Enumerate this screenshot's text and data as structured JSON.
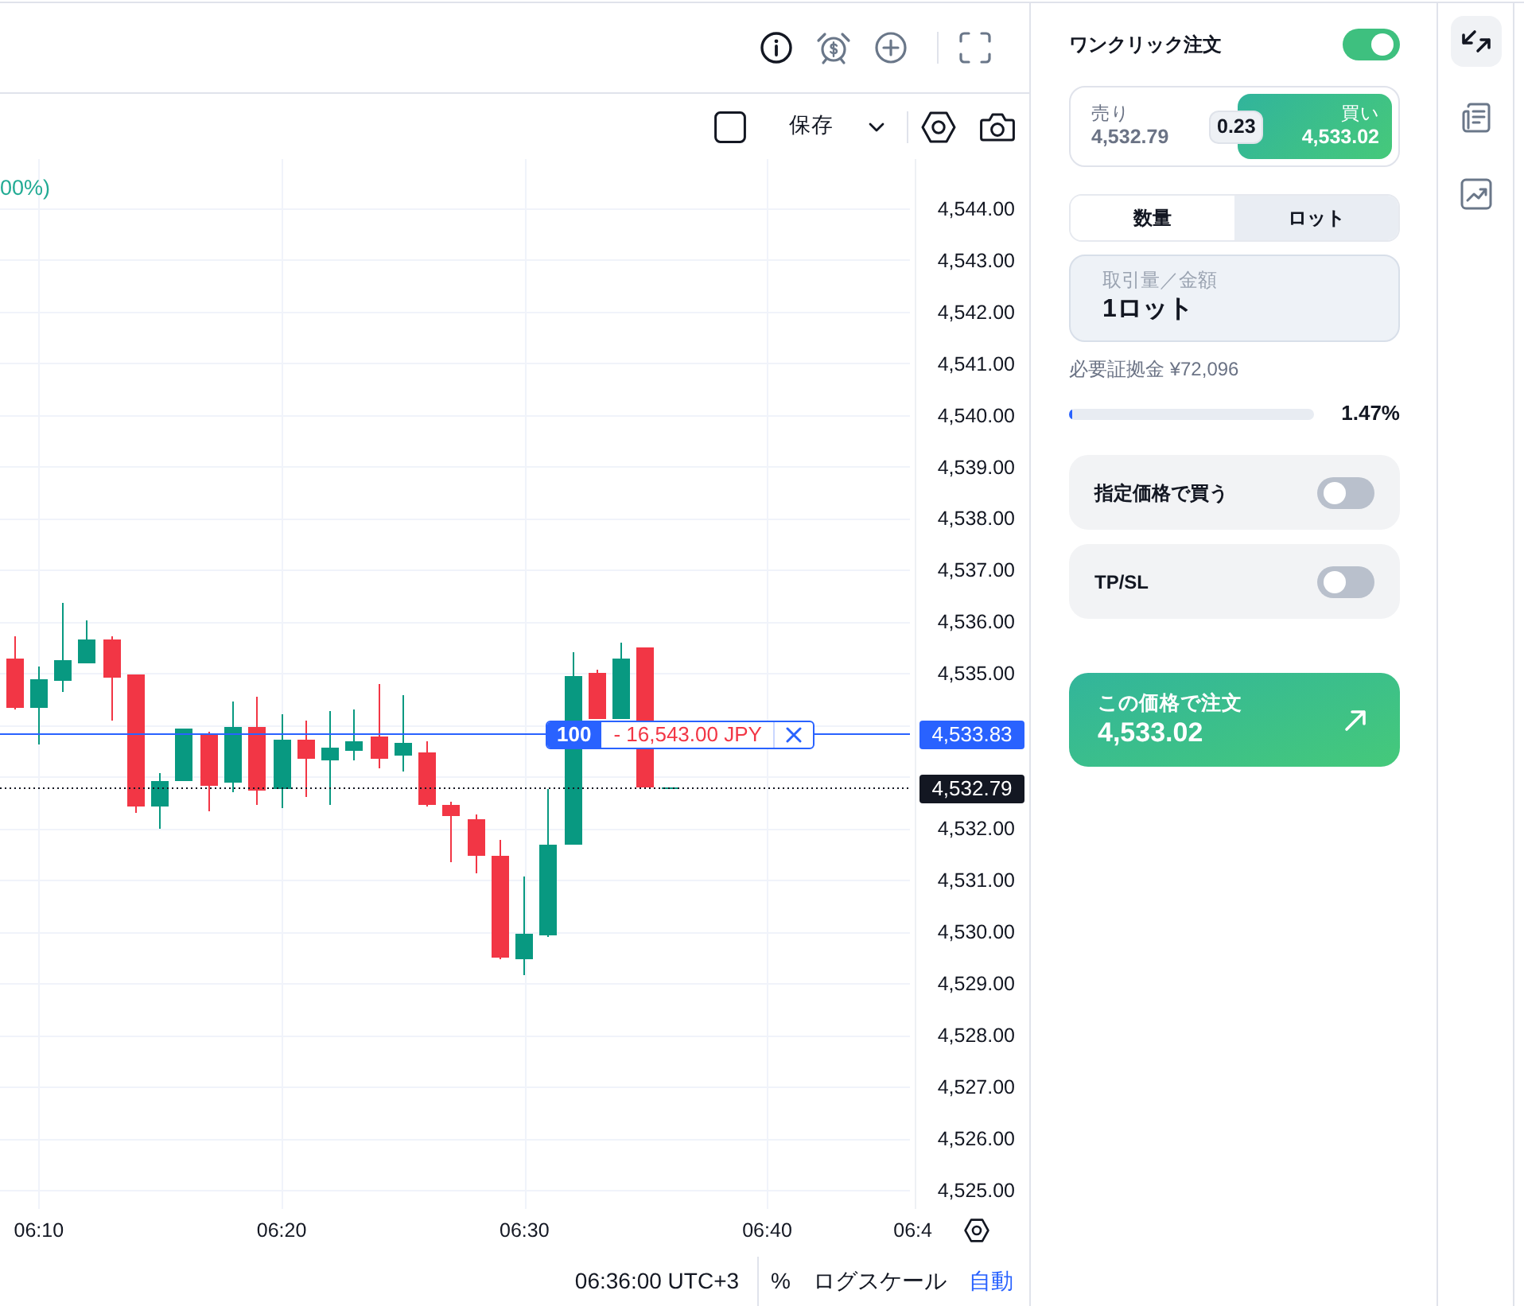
{
  "chart_toolbar": {
    "save_label": "保存"
  },
  "chart": {
    "legend": "00%)",
    "position_label": {
      "quantity": "100",
      "pnl": "- 16,543.00 JPY"
    },
    "chart_data": {
      "type": "candlestick",
      "grid": true,
      "categories": [
        null,
        "06:10",
        null,
        null,
        null,
        null,
        null,
        null,
        null,
        null,
        null,
        "06:20",
        null,
        null,
        null,
        null,
        null,
        null,
        null,
        null,
        null,
        "06:30",
        null,
        null,
        null,
        null,
        null,
        null,
        null,
        null,
        null,
        "06:40",
        null,
        null,
        null,
        null,
        null,
        "06:4"
      ],
      "ohlc": [
        [
          4535.28,
          4535.72,
          4534.3,
          4534.33
        ],
        [
          4534.33,
          4535.13,
          4533.62,
          4534.88
        ],
        [
          4534.85,
          4536.36,
          4534.64,
          4535.25
        ],
        [
          4535.19,
          4536.02,
          4535.19,
          4535.65
        ],
        [
          4535.65,
          4535.72,
          4534.08,
          4534.91
        ],
        [
          4534.98,
          4534.98,
          4532.3,
          4532.42
        ],
        [
          4532.42,
          4533.07,
          4531.99,
          4532.91
        ],
        [
          4532.91,
          4533.93,
          4532.91,
          4533.93
        ],
        [
          4533.84,
          4533.87,
          4532.33,
          4532.82
        ],
        [
          4532.88,
          4534.45,
          4532.7,
          4533.96
        ],
        [
          4533.96,
          4534.55,
          4532.45,
          4532.73
        ],
        [
          4532.76,
          4534.21,
          4532.39,
          4533.71
        ],
        [
          4533.71,
          4534.08,
          4532.61,
          4533.34
        ],
        [
          4533.31,
          4534.27,
          4532.45,
          4533.56
        ],
        [
          4533.5,
          4534.3,
          4533.31,
          4533.68
        ],
        [
          4533.78,
          4534.79,
          4533.16,
          4533.34
        ],
        [
          4533.41,
          4534.58,
          4533.1,
          4533.65
        ],
        [
          4533.47,
          4533.68,
          4532.42,
          4532.45
        ],
        [
          4532.45,
          4532.51,
          4531.34,
          4532.24
        ],
        [
          4532.17,
          4532.27,
          4531.13,
          4531.47
        ],
        [
          4531.47,
          4531.77,
          4529.46,
          4529.49
        ],
        [
          4529.46,
          4531.07,
          4529.16,
          4529.96
        ],
        [
          4529.93,
          4532.76,
          4529.89,
          4531.68
        ],
        [
          4531.68,
          4535.41,
          4531.68,
          4534.95
        ],
        [
          4535.01,
          4535.07,
          4534.1,
          4534.1
        ],
        [
          4534.1,
          4535.59,
          4534.1,
          4535.28
        ],
        [
          4535.5,
          4535.5,
          4532.79,
          4532.79
        ],
        [
          4532.79,
          4532.79,
          4532.79,
          4532.79
        ],
        null,
        null,
        null,
        null,
        null,
        null,
        null,
        null,
        null,
        null
      ],
      "ylim": [
        4524.63,
        4544.95
      ],
      "yticks": [
        {
          "value": 4525,
          "label": "4,525.00"
        },
        {
          "value": 4526,
          "label": "4,526.00"
        },
        {
          "value": 4527,
          "label": "4,527.00"
        },
        {
          "value": 4528,
          "label": "4,528.00"
        },
        {
          "value": 4529,
          "label": "4,529.00"
        },
        {
          "value": 4530,
          "label": "4,530.00"
        },
        {
          "value": 4531,
          "label": "4,531.00"
        },
        {
          "value": 4532,
          "label": "4,532.00"
        },
        {
          "value": 4535,
          "label": "4,535.00"
        },
        {
          "value": 4536,
          "label": "4,536.00"
        },
        {
          "value": 4537,
          "label": "4,537.00"
        },
        {
          "value": 4538,
          "label": "4,538.00"
        },
        {
          "value": 4539,
          "label": "4,539.00"
        },
        {
          "value": 4540,
          "label": "4,540.00"
        },
        {
          "value": 4541,
          "label": "4,541.00"
        },
        {
          "value": 4542,
          "label": "4,542.00"
        },
        {
          "value": 4543,
          "label": "4,543.00"
        },
        {
          "value": 4544,
          "label": "4,544.00"
        }
      ],
      "ref_lines": [
        {
          "axis": "y",
          "value": 4533.83,
          "label": "4,533.83",
          "color": "#2962ff"
        },
        {
          "axis": "y",
          "value": 4532.79,
          "label": "4,532.79",
          "color": "#131722"
        }
      ]
    }
  },
  "status_bar": {
    "time": "06:36:00 UTC+3",
    "scale_options": [
      {
        "label": "%",
        "on": false
      },
      {
        "label": "ログスケール",
        "on": false
      },
      {
        "label": "自動",
        "on": true
      }
    ]
  },
  "order_panel": {
    "one_click": {
      "label": "ワンクリック注文",
      "on": true
    },
    "quote": {
      "sides": [
        {
          "kind": "sell",
          "label": "売り",
          "price": "4,532.79",
          "selected": false
        },
        {
          "kind": "buy",
          "label": "買い",
          "price": "4,533.02",
          "selected": true
        }
      ],
      "spread": "0.23"
    },
    "unit_tabs": [
      {
        "label": "数量",
        "selected": false
      },
      {
        "label": "ロット",
        "selected": true
      }
    ],
    "amount_field": {
      "label": "取引量／金額",
      "value": "1ロット"
    },
    "margin": {
      "text": "必要証拠金 ¥72,096",
      "level": 0.0147,
      "reading": "1.47%"
    },
    "options": [
      {
        "label": "指定価格で買う",
        "on": false
      },
      {
        "label": "TP/SL",
        "on": false
      }
    ],
    "order_button": {
      "title": "この価格で注文",
      "price": "4,533.02"
    }
  },
  "side_tools": [
    {
      "selected": true
    },
    {
      "selected": false
    },
    {
      "selected": false
    }
  ]
}
